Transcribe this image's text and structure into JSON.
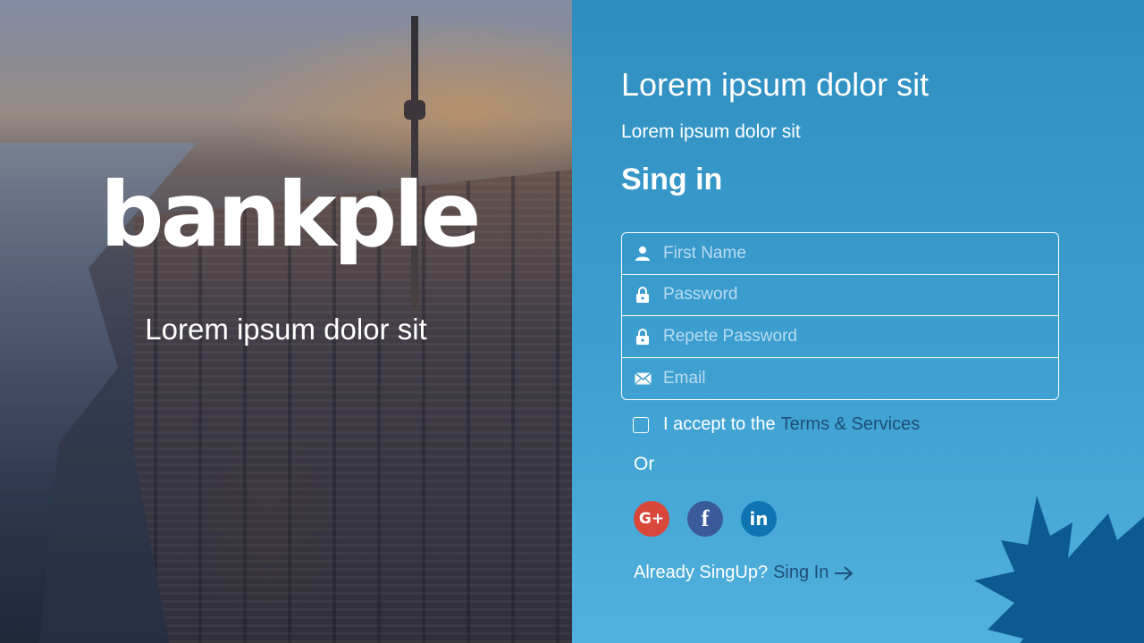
{
  "brand": {
    "logo_text": "bankple",
    "tagline": "Lorem ipsum dolor sit"
  },
  "form_panel": {
    "heading": "Lorem ipsum dolor sit",
    "subheading": "Lorem ipsum dolor sit",
    "title": "Sing in",
    "fields": [
      {
        "icon": "user-icon",
        "placeholder": "First Name",
        "value": ""
      },
      {
        "icon": "lock-icon",
        "placeholder": "Password",
        "value": ""
      },
      {
        "icon": "lock-icon",
        "placeholder": "Repete Password",
        "value": ""
      },
      {
        "icon": "mail-icon",
        "placeholder": "Email",
        "value": ""
      }
    ],
    "accept": {
      "checked": false,
      "text": "I accept to the",
      "link_text": "Terms & Services"
    },
    "or_text": "Or",
    "socials": [
      {
        "name": "google",
        "glyph": "G+",
        "color": "#d9473b"
      },
      {
        "name": "facebook",
        "glyph": "f",
        "color": "#3b5a9a"
      },
      {
        "name": "linkedin",
        "glyph": "in",
        "color": "#0f74b2"
      }
    ],
    "already": {
      "text": "Already SingUp?",
      "link_text": "Sing In"
    }
  },
  "colors": {
    "panel_top": "#2e8ebf",
    "panel_bottom": "#51b1de",
    "link": "#1e4d78",
    "leaf": "#0d5a92"
  }
}
